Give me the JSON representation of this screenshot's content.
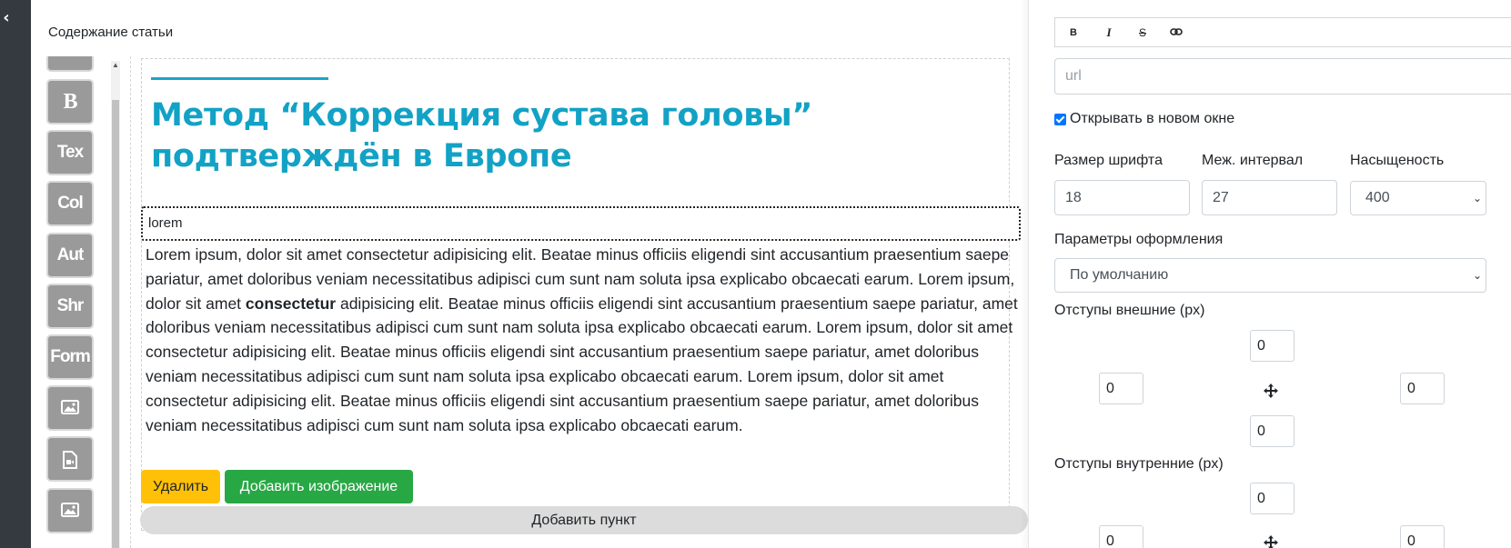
{
  "rail": {
    "toggle_icon": "chevron-left-icon"
  },
  "editor": {
    "section_title": "Содержание статьи",
    "tools": [
      {
        "label": "B",
        "icon": "bold-block-icon"
      },
      {
        "label": "Tex"
      },
      {
        "label": "Col"
      },
      {
        "label": "Aut"
      },
      {
        "label": "Shr"
      },
      {
        "label": "Form"
      },
      {
        "label": "",
        "icon": "image-icon"
      },
      {
        "label": "",
        "icon": "video-file-icon"
      },
      {
        "label": "",
        "icon": "image-icon"
      }
    ],
    "headline": "Метод “Коррекция сустава головы” подтверждён в Европе",
    "subheading": "lorem",
    "body": {
      "part1": "Lorem ipsum, dolor sit amet consectetur adipisicing elit. Beatae minus officiis eligendi sint accusantium praesentium saepe pariatur, amet doloribus veniam necessitatibus adipisci cum sunt nam soluta ipsa explicabo obcaecati earum. Lorem ipsum, dolor sit amet ",
      "bold": "consectetur",
      "part2": " adipisicing elit. Beatae minus officiis eligendi sint accusantium praesentium saepe pariatur, amet doloribus veniam necessitatibus adipisci cum sunt nam soluta ipsa explicabo obcaecati earum. Lorem ipsum, dolor sit amet consectetur adipisicing elit. Beatae minus officiis eligendi sint accusantium praesentium saepe pariatur, amet doloribus veniam necessitatibus adipisci cum sunt nam soluta ipsa explicabo obcaecati earum. Lorem ipsum, dolor sit amet consectetur adipisicing elit. Beatae minus officiis eligendi sint accusantium praesentium saepe pariatur, amet doloribus veniam necessitatibus adipisci cum sunt nam soluta ipsa explicabo obcaecati earum."
    },
    "buttons": {
      "delete": "Удалить",
      "add_image": "Добавить изображение",
      "add_item": "Добавить пункт"
    },
    "colors": {
      "headline": "#12a2c5",
      "delete": "#ffc107",
      "add_image": "#28a745"
    }
  },
  "panel": {
    "format_buttons": [
      {
        "label": "B",
        "icon": "bold-icon"
      },
      {
        "label": "I",
        "icon": "italic-icon"
      },
      {
        "label": "S",
        "icon": "strikethrough-icon"
      },
      {
        "label": "",
        "icon": "link-icon"
      }
    ],
    "url_placeholder": "url",
    "open_new_window": {
      "label": "Открывать в новом окне",
      "checked": true
    },
    "font_size": {
      "label": "Размер шрифта",
      "value": "18"
    },
    "line_height": {
      "label": "Меж. интервал",
      "value": "27"
    },
    "font_weight": {
      "label": "Насыщеность",
      "value": "400"
    },
    "style_params": {
      "label": "Параметры оформления",
      "value": "По умолчанию"
    },
    "margins": {
      "label": "Отступы внешние (px)",
      "top": "0",
      "left": "0",
      "right": "0",
      "bottom": "0",
      "icon": "move-icon"
    },
    "paddings": {
      "label": "Отступы внутренние (px)",
      "top": "0",
      "left": "0",
      "right": "0",
      "icon": "move-icon"
    }
  }
}
